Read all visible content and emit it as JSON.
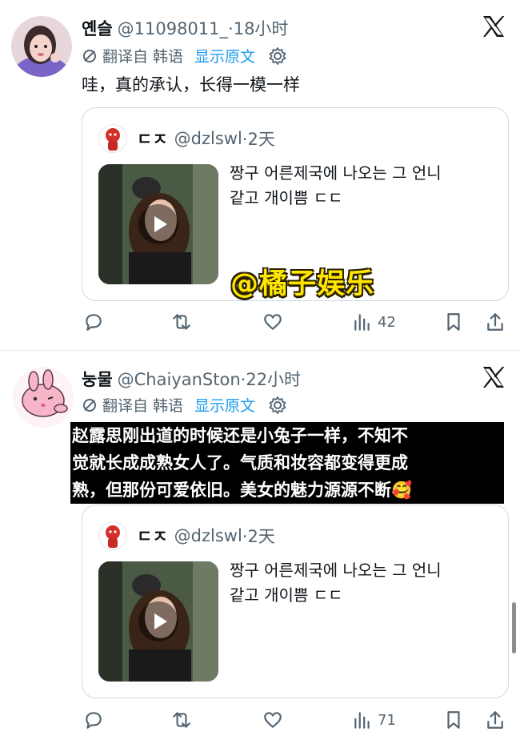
{
  "tweets": [
    {
      "name": "옌슬",
      "handle": "@11098011_",
      "time": "·18小时",
      "translate_label": "翻译自 韩语",
      "show_original": "显示原文",
      "text": "哇，真的承认，长得一模一样",
      "quote": {
        "name": "ㄷㅈ",
        "handle": "@dzlswl",
        "time": "·2天",
        "line1": "짱구 어른제국에 나오는 그 언니",
        "line2": "같고 개이쁨 ㄷㄷ"
      },
      "views": "42"
    },
    {
      "name": "눙물",
      "handle": "@ChaiyanSton",
      "time": "·22小时",
      "translate_label": "翻译自 韩语",
      "show_original": "显示原文",
      "overlay_lines": [
        "赵露思刚出道的时候还是小兔子一样，不知不",
        "觉就长成成熟女人了。气质和妆容都变得更成",
        "熟，但那份可爱依旧。美女的魅力源源不断🥰"
      ],
      "quote": {
        "name": "ㄷㅈ",
        "handle": "@dzlswl",
        "time": "·2天",
        "line1": "짱구 어른제국에 나오는 그 언니",
        "line2": "같고 개이쁨 ㄷㄷ"
      },
      "views": "71"
    }
  ],
  "watermark": "@橘子娱乐",
  "icons": [
    "x-logo-icon",
    "translate-icon",
    "settings-icon",
    "reply-icon",
    "retweet-icon",
    "like-icon",
    "views-icon",
    "bookmark-icon",
    "share-icon",
    "play-icon"
  ],
  "colors": {
    "link": "#1d9bf0",
    "muted": "#536471",
    "border": "#cfd9de",
    "watermark": "#ffe600"
  }
}
